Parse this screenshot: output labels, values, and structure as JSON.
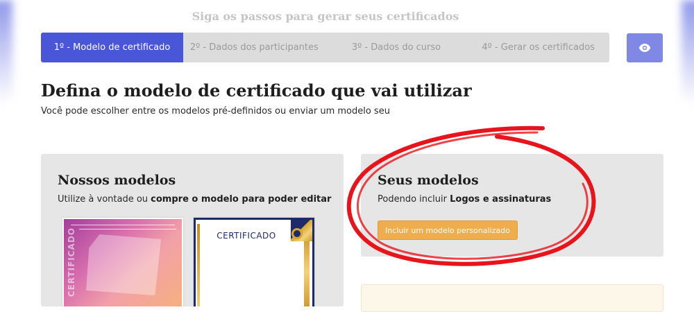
{
  "header": {
    "title": "Siga os passos para gerar seus certificados"
  },
  "stepper": {
    "steps": [
      {
        "label": "1º - Modelo de certificado",
        "active": true
      },
      {
        "label": "2º - Dados dos participantes",
        "active": false
      },
      {
        "label": "3º - Dados do curso",
        "active": false
      },
      {
        "label": "4º - Gerar os certificados",
        "active": false
      }
    ],
    "preview_icon": "eye-icon"
  },
  "main": {
    "title": "Defina o modelo de certificado que vai utilizar",
    "subtitle": "Você pode escolher entre os modelos pré-definidos ou enviar um modelo seu"
  },
  "our_models": {
    "heading": "Nossos modelos",
    "desc_prefix": "Utilize à vontade ou ",
    "desc_bold": "compre o modelo para poder editar",
    "thumbnails": [
      {
        "text": "CERTIFICADO"
      },
      {
        "text": "CERTIFICADO"
      }
    ]
  },
  "your_models": {
    "heading": "Seus modelos",
    "desc_prefix": "Podendo incluir ",
    "desc_bold": "Logos e assinaturas",
    "button_label": "Incluir um modelo personalizado"
  },
  "colors": {
    "accent": "#4a56d8",
    "preview_button": "#7f88e4",
    "action_button": "#f0ad4e",
    "highlight": "#e8141b"
  }
}
